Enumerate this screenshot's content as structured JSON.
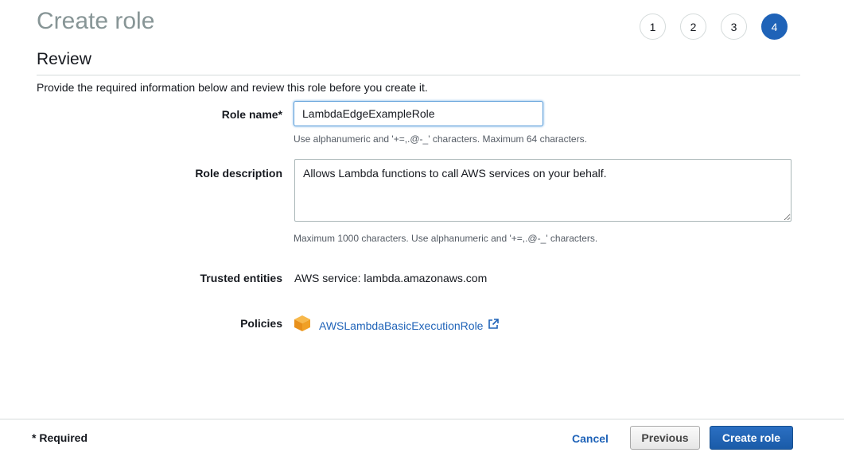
{
  "page": {
    "title": "Create role",
    "steps": [
      "1",
      "2",
      "3",
      "4"
    ],
    "active_step": 4
  },
  "review": {
    "heading": "Review",
    "intro": "Provide the required information below and review this role before you create it."
  },
  "form": {
    "role_name_label": "Role name*",
    "role_name_value": "LambdaEdgeExampleRole",
    "role_name_hint": "Use alphanumeric and '+=,.@-_' characters. Maximum 64 characters.",
    "role_description_label": "Role description",
    "role_description_value": "Allows Lambda functions to call AWS services on your behalf.",
    "role_description_hint": "Maximum 1000 characters. Use alphanumeric and '+=,.@-_' characters.",
    "trusted_entities_label": "Trusted entities",
    "trusted_entities_value": "AWS service: lambda.amazonaws.com",
    "policies_label": "Policies",
    "policies": [
      {
        "name": "AWSLambdaBasicExecutionRole",
        "icon": "policy-cube-icon"
      }
    ]
  },
  "footer": {
    "required_note": "* Required",
    "cancel_label": "Cancel",
    "previous_label": "Previous",
    "create_label": "Create role"
  },
  "colors": {
    "accent": "#1f63b8",
    "policy_icon": "#f0a026",
    "title": "#879596"
  }
}
